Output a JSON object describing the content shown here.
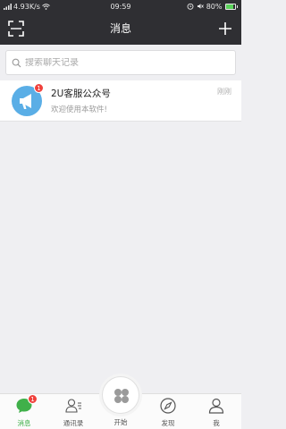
{
  "status_bar": {
    "left_text": "4.93K/s",
    "time": "09:59",
    "battery": "80%",
    "battery_level": 0.8
  },
  "header": {
    "title": "消息",
    "scan_icon": "scan-icon",
    "add_icon": "plus-icon"
  },
  "search": {
    "placeholder": "搜索聊天记录",
    "icon": "search-icon"
  },
  "messages": [
    {
      "name": "2U客服公众号",
      "preview": "欢迎使用本软件!",
      "time": "刚刚",
      "unread": "1",
      "avatar_icon": "megaphone-icon",
      "avatar_color": "#5aaee6"
    }
  ],
  "tabs": [
    {
      "label": "消息",
      "icon": "chat-bubble-icon",
      "badge": "1",
      "active": true
    },
    {
      "label": "通讯录",
      "icon": "contacts-icon"
    },
    {
      "label": "开始",
      "icon": "grid-flower-icon"
    },
    {
      "label": "发现",
      "icon": "compass-icon"
    },
    {
      "label": "我",
      "icon": "person-icon"
    }
  ],
  "colors": {
    "header_bg": "#2f2f33",
    "accent_green": "#40b04a",
    "badge_red": "#f0413c",
    "avatar_blue": "#5aaee6"
  }
}
